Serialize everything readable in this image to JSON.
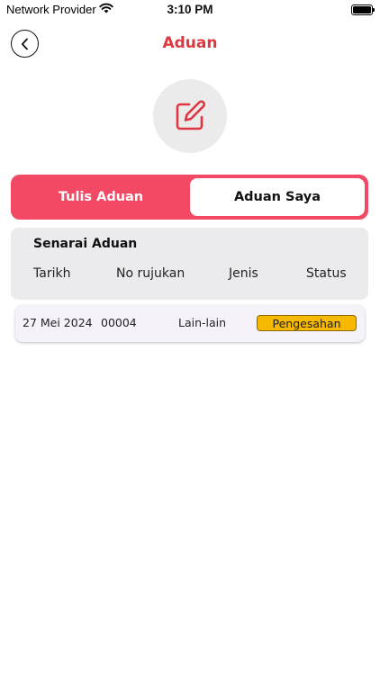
{
  "status_bar": {
    "carrier": "Network Provider",
    "time": "3:10 PM"
  },
  "header": {
    "title": "Aduan"
  },
  "tabs": {
    "left": "Tulis Aduan",
    "right": "Aduan Saya",
    "active": "Aduan Saya"
  },
  "list": {
    "title": "Senarai Aduan",
    "columns": [
      "Tarikh",
      "No rujukan",
      "Jenis",
      "Status"
    ],
    "rows": [
      {
        "date": "27 Mei 2024",
        "ref": "00004",
        "type": "Lain-lain",
        "status": "Pengesahan"
      }
    ]
  },
  "colors": {
    "accent": "#e03640",
    "tab_bg": "#f24965",
    "status_badge": "#f6b800"
  }
}
